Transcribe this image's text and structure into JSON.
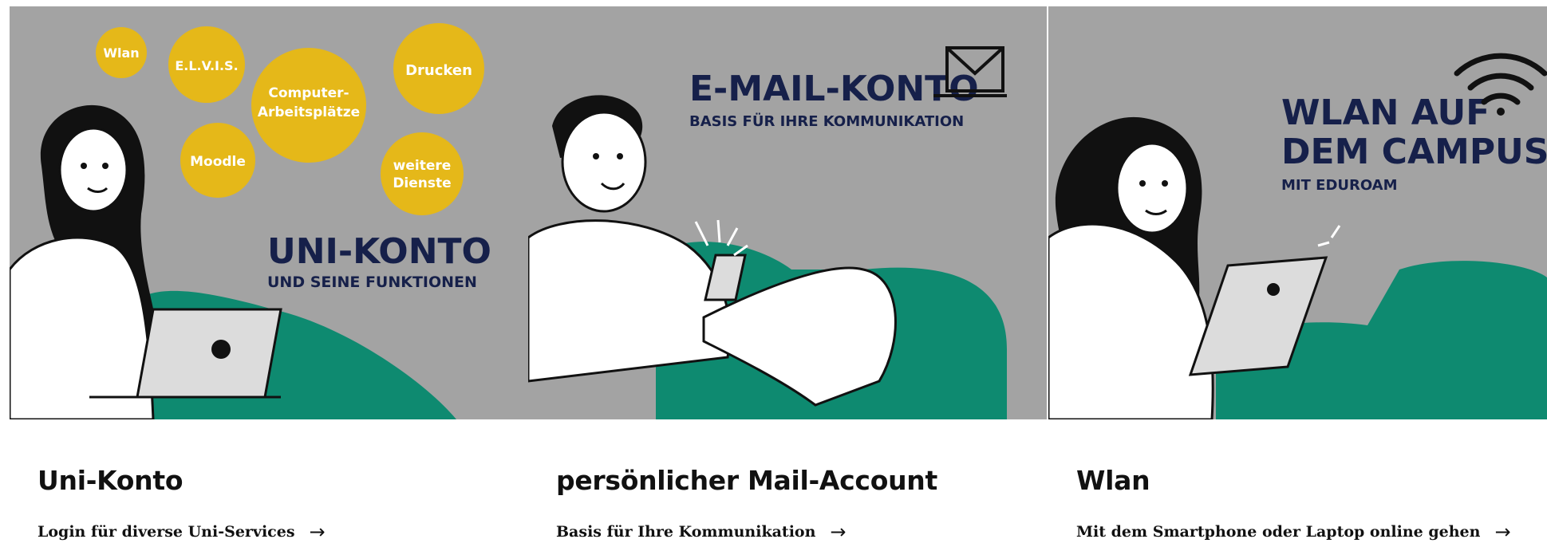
{
  "colors": {
    "illustration_bg": "#a3a3a3",
    "bubble_yellow": "#e5b819",
    "couch_green": "#0e8a70",
    "headline_navy": "#16204a"
  },
  "cards": [
    {
      "title": "Uni-Konto",
      "link": "Login für diverse Uni-Services",
      "arrow": "→",
      "image": {
        "headline": "UNI-KONTO",
        "subline": "UND SEINE FUNKTIONEN",
        "bubbles": {
          "wlan": "Wlan",
          "elvis": "E.L.V.I.S.",
          "computer_1": "Computer-",
          "computer_2": "Arbeitsplätze",
          "drucken": "Drucken",
          "moodle": "Moodle",
          "weitere_1": "weitere",
          "weitere_2": "Dienste"
        }
      }
    },
    {
      "title": "persönlicher Mail-Account",
      "link": "Basis für Ihre Kommunikation",
      "arrow": "→",
      "image": {
        "headline": "E-MAIL-KONTO",
        "subline": "BASIS FÜR IHRE KOMMUNIKATION",
        "icon": "envelope-icon"
      }
    },
    {
      "title": "Wlan",
      "link": "Mit dem Smartphone oder Laptop online gehen",
      "arrow": "→",
      "image": {
        "headline_1": "WLAN AUF",
        "headline_2": "DEM CAMPUS",
        "subline": "MIT EDUROAM",
        "icon": "wifi-icon"
      }
    }
  ]
}
